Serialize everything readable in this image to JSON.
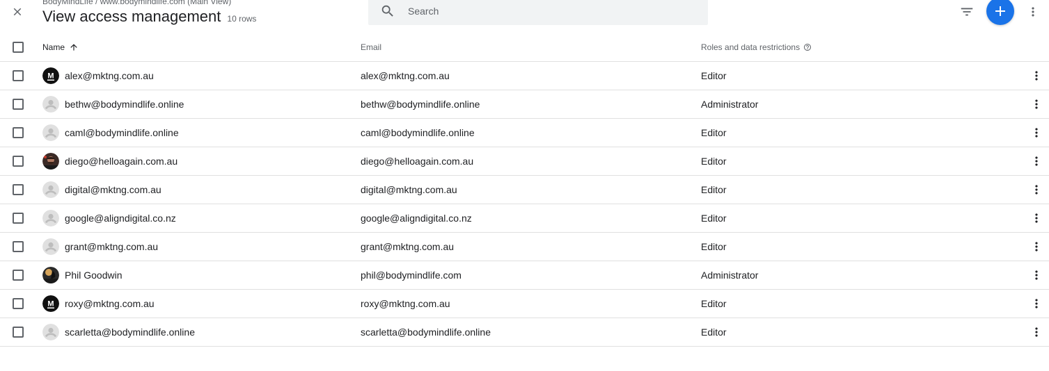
{
  "header": {
    "breadcrumb": "BodyMindLife / www.bodymindlife.com (Main View)",
    "title": "View access management",
    "row_count": "10 rows",
    "search_placeholder": "Search",
    "accent_color": "#1a73e8"
  },
  "table": {
    "columns": {
      "name": "Name",
      "email": "Email",
      "roles": "Roles and data restrictions"
    },
    "rows": [
      {
        "name": "alex@mktng.com.au",
        "email": "alex@mktng.com.au",
        "role": "Editor",
        "avatar": "m-logo"
      },
      {
        "name": "bethw@bodymindlife.online",
        "email": "bethw@bodymindlife.online",
        "role": "Administrator",
        "avatar": "default-person"
      },
      {
        "name": "caml@bodymindlife.online",
        "email": "caml@bodymindlife.online",
        "role": "Editor",
        "avatar": "default-person"
      },
      {
        "name": "diego@helloagain.com.au",
        "email": "diego@helloagain.com.au",
        "role": "Editor",
        "avatar": "photo-diego"
      },
      {
        "name": "digital@mktng.com.au",
        "email": "digital@mktng.com.au",
        "role": "Editor",
        "avatar": "default-person"
      },
      {
        "name": "google@aligndigital.co.nz",
        "email": "google@aligndigital.co.nz",
        "role": "Editor",
        "avatar": "default-person"
      },
      {
        "name": "grant@mktng.com.au",
        "email": "grant@mktng.com.au",
        "role": "Editor",
        "avatar": "default-person"
      },
      {
        "name": "Phil Goodwin",
        "email": "phil@bodymindlife.com",
        "role": "Administrator",
        "avatar": "photo-phil"
      },
      {
        "name": "roxy@mktng.com.au",
        "email": "roxy@mktng.com.au",
        "role": "Editor",
        "avatar": "m-logo"
      },
      {
        "name": "scarletta@bodymindlife.online",
        "email": "scarletta@bodymindlife.online",
        "role": "Editor",
        "avatar": "default-person"
      }
    ]
  },
  "icons": {
    "close": "close-icon",
    "search": "search-icon",
    "filter": "filter-icon",
    "add": "add-icon",
    "more": "more-vert-icon",
    "sort": "arrow-up-icon",
    "help": "help-icon"
  }
}
